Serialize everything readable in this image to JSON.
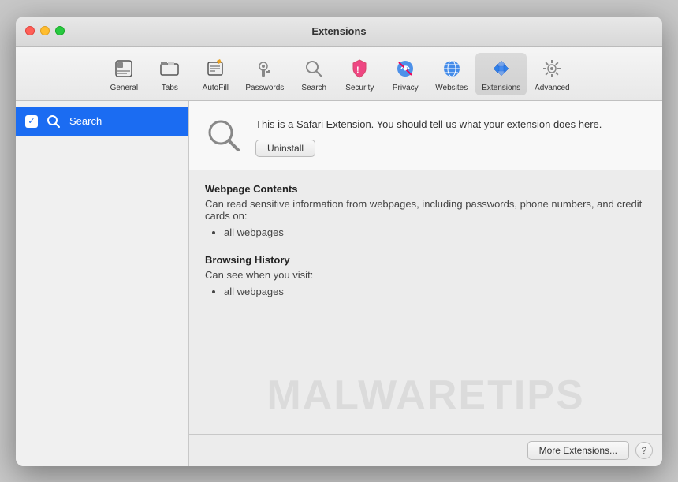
{
  "window": {
    "title": "Extensions"
  },
  "toolbar": {
    "items": [
      {
        "id": "general",
        "label": "General",
        "icon": "general"
      },
      {
        "id": "tabs",
        "label": "Tabs",
        "icon": "tabs"
      },
      {
        "id": "autofill",
        "label": "AutoFill",
        "icon": "autofill"
      },
      {
        "id": "passwords",
        "label": "Passwords",
        "icon": "passwords"
      },
      {
        "id": "search",
        "label": "Search",
        "icon": "search"
      },
      {
        "id": "security",
        "label": "Security",
        "icon": "security"
      },
      {
        "id": "privacy",
        "label": "Privacy",
        "icon": "privacy"
      },
      {
        "id": "websites",
        "label": "Websites",
        "icon": "websites"
      },
      {
        "id": "extensions",
        "label": "Extensions",
        "icon": "extensions",
        "active": true
      },
      {
        "id": "advanced",
        "label": "Advanced",
        "icon": "advanced"
      }
    ]
  },
  "sidebar": {
    "items": [
      {
        "id": "search-extension",
        "label": "Search",
        "checked": true,
        "selected": true
      }
    ]
  },
  "detail": {
    "extension_description": "This is a Safari Extension. You should tell us what your extension does here.",
    "uninstall_button": "Uninstall",
    "sections": [
      {
        "title": "Webpage Contents",
        "description": "Can read sensitive information from webpages, including passwords, phone numbers, and credit cards on:",
        "items": [
          "all webpages"
        ]
      },
      {
        "title": "Browsing History",
        "description": "Can see when you visit:",
        "items": [
          "all webpages"
        ]
      }
    ]
  },
  "footer": {
    "more_extensions_label": "More Extensions...",
    "help_label": "?"
  },
  "watermark": {
    "text": "MALWARETIPS"
  }
}
